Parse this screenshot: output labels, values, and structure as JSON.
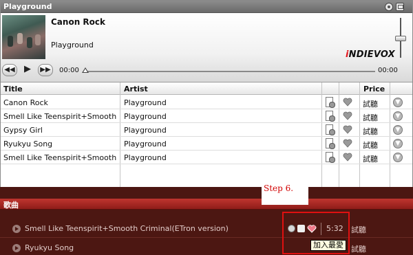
{
  "window": {
    "title": "Playground"
  },
  "now_playing": {
    "title": "Canon Rock",
    "artist": "Playground",
    "brand_prefix": "i",
    "brand_main": "NDIEVOX",
    "current_time": "00:00",
    "duration": "00:00",
    "progress_fraction": 0,
    "volume_fraction": 0.5
  },
  "table": {
    "headers": {
      "title": "Title",
      "artist": "Artist",
      "price": "Price"
    },
    "rows": [
      {
        "title": "Canon Rock",
        "artist": "Playground",
        "price": "試聽"
      },
      {
        "title": "Smell Like Teenspirit+Smooth C",
        "artist": "Playground",
        "price": "試聽"
      },
      {
        "title": "Gypsy Girl",
        "artist": "Playground",
        "price": "試聽"
      },
      {
        "title": "Ryukyu Song",
        "artist": "Playground",
        "price": "試聽"
      },
      {
        "title": "Smell Like Teenspirit+Smooth C",
        "artist": "Playground",
        "price": "試聽"
      }
    ]
  },
  "song_panel": {
    "header": "歌曲",
    "items": [
      {
        "title": "Smell Like Teenspirit+Smooth Criminal(ETron version)",
        "duration": "5:32",
        "price": "試聽"
      },
      {
        "title": "Ryukyu Song",
        "duration": "",
        "price": "試聽"
      }
    ]
  },
  "annotation": {
    "step_label": "Step 6.",
    "tooltip": "加入最愛"
  },
  "colors": {
    "brand_red": "#e2141b",
    "panel_dark": "#4c1712",
    "panel_bar": "#c0352f",
    "highlight": "#e01010"
  }
}
